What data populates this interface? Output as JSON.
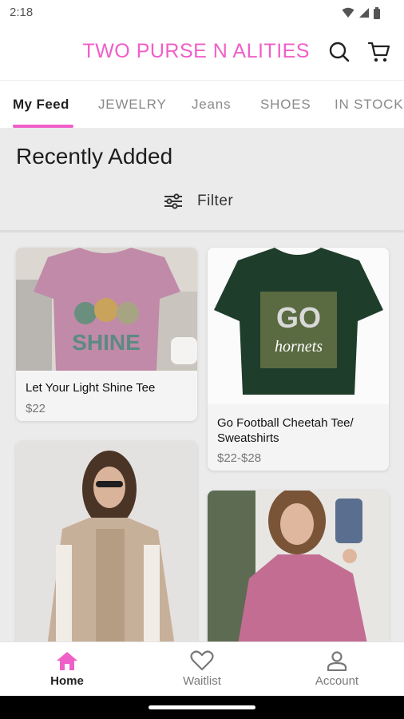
{
  "status_bar": {
    "time": "2:18"
  },
  "header": {
    "title": "TWO PURSE N ALITIES",
    "brand_color": "#f05fc8"
  },
  "tabs": [
    {
      "label": "My Feed",
      "active": true
    },
    {
      "label": "JEWELRY"
    },
    {
      "label": "Jeans"
    },
    {
      "label": "SHOES"
    },
    {
      "label": "IN STOCK"
    }
  ],
  "section": {
    "title": "Recently Added"
  },
  "filter": {
    "label": "Filter"
  },
  "products": [
    {
      "name": "Let Your Light Shine Tee",
      "price": "$22",
      "shirt_text": "SHINE",
      "shirt_color": "#c08aa8"
    },
    {
      "name": "Go Football Cheetah Tee/ Sweatshirts",
      "price": "$22-$28",
      "shirt_text_1": "GO",
      "shirt_text_2": "hornets",
      "shirt_color": "#1f3d2b"
    },
    {
      "name": "",
      "price": ""
    },
    {
      "name": "",
      "price": ""
    }
  ],
  "bottom_nav": [
    {
      "label": "Home",
      "icon": "home-icon",
      "active": true
    },
    {
      "label": "Waitlist",
      "icon": "heart-icon"
    },
    {
      "label": "Account",
      "icon": "account-icon"
    }
  ]
}
